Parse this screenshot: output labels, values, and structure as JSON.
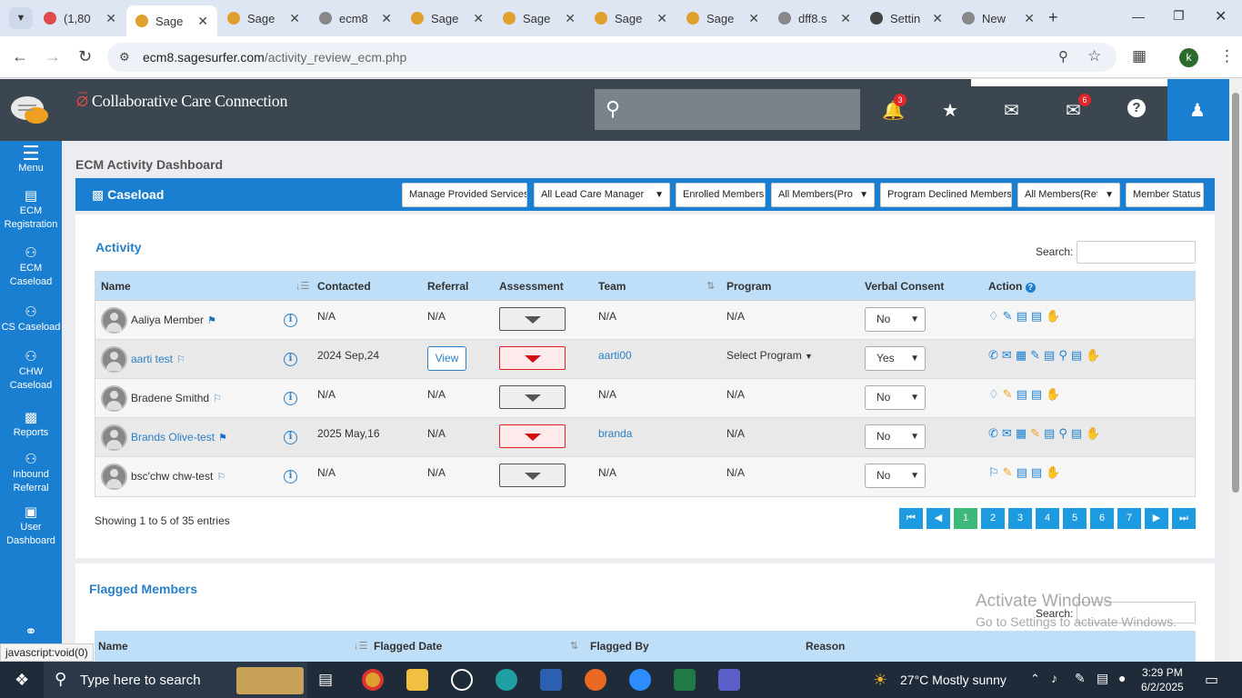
{
  "browser": {
    "tabs": [
      {
        "title": "(1,80",
        "fav": "#e04a4a",
        "icon": "g"
      },
      {
        "title": "Sage",
        "fav": "#e0a030",
        "active": true
      },
      {
        "title": "Sage",
        "fav": "#e0a030"
      },
      {
        "title": "ecm8",
        "fav": "#888"
      },
      {
        "title": "Sage",
        "fav": "#e0a030"
      },
      {
        "title": "Sage",
        "fav": "#e0a030"
      },
      {
        "title": "Sage",
        "fav": "#e0a030"
      },
      {
        "title": "Sage",
        "fav": "#e0a030"
      },
      {
        "title": "dff8.s",
        "fav": "#888"
      },
      {
        "title": "Settin",
        "fav": "#444"
      },
      {
        "title": "New",
        "fav": "#888"
      }
    ],
    "url_host": "ecm8.sagesurfer.com",
    "url_path": "/activity_review_ecm.php",
    "profile_initial": "k"
  },
  "header": {
    "brand": "Collaborative Care Connection",
    "notif_count": "3",
    "mail_count": "6"
  },
  "sidebar": {
    "menu": "Menu",
    "items": [
      {
        "label": "ECM Registration"
      },
      {
        "label": "ECM Caseload"
      },
      {
        "label": "CS Caseload"
      },
      {
        "label": "CHW Caseload"
      },
      {
        "label": "Reports"
      },
      {
        "label": "Inbound Referral"
      },
      {
        "label": "User Dashboard"
      }
    ]
  },
  "main": {
    "title": "ECM Activity Dashboard",
    "caseload": "Caseload",
    "toolbar": {
      "manage": "Manage Provided Services",
      "lead": "All Lead Care Manager",
      "enrolled": "Enrolled Members",
      "all_prog": "All Members(Program",
      "declined": "Program Declined Members",
      "all_ref": "All Members(Referral",
      "status": "Member Status"
    },
    "activity": {
      "title": "Activity",
      "search_label": "Search:",
      "headers": {
        "name": "Name",
        "contacted": "Contacted",
        "referral": "Referral",
        "assessment": "Assessment",
        "team": "Team",
        "program": "Program",
        "consent": "Verbal Consent",
        "action": "Action"
      },
      "rows": [
        {
          "name": "Aaliya Member",
          "contacted": "N/A",
          "referral": "N/A",
          "team": "N/A",
          "program": "N/A",
          "consent": "No"
        },
        {
          "name": "aarti test",
          "contacted": "2024 Sep,24",
          "referral": "View",
          "team": "aarti00",
          "program": "Select Program",
          "consent": "Yes"
        },
        {
          "name": "Bradene Smithd",
          "contacted": "N/A",
          "referral": "N/A",
          "team": "N/A",
          "program": "N/A",
          "consent": "No"
        },
        {
          "name": "Brands Olive-test",
          "contacted": "2025 May,16",
          "referral": "N/A",
          "team": "branda",
          "program": "N/A",
          "consent": "No"
        },
        {
          "name": "bsc'chw chw-test",
          "contacted": "N/A",
          "referral": "N/A",
          "team": "N/A",
          "program": "N/A",
          "consent": "No"
        }
      ],
      "showing": "Showing 1 to 5 of 35 entries",
      "pages": [
        "1",
        "2",
        "3",
        "4",
        "5",
        "6",
        "7"
      ]
    },
    "flagged": {
      "title": "Flagged Members",
      "search_label": "Search:",
      "headers": {
        "name": "Name",
        "date": "Flagged Date",
        "by": "Flagged By",
        "reason": "Reason"
      }
    }
  },
  "watermark": {
    "line1": "Activate Windows",
    "line2": "Go to Settings to activate Windows."
  },
  "status_text": "javascript:void(0)",
  "taskbar": {
    "search": "Type here to search",
    "weather": "27°C  Mostly sunny",
    "time": "3:29 PM",
    "date": "6/2/2025"
  }
}
